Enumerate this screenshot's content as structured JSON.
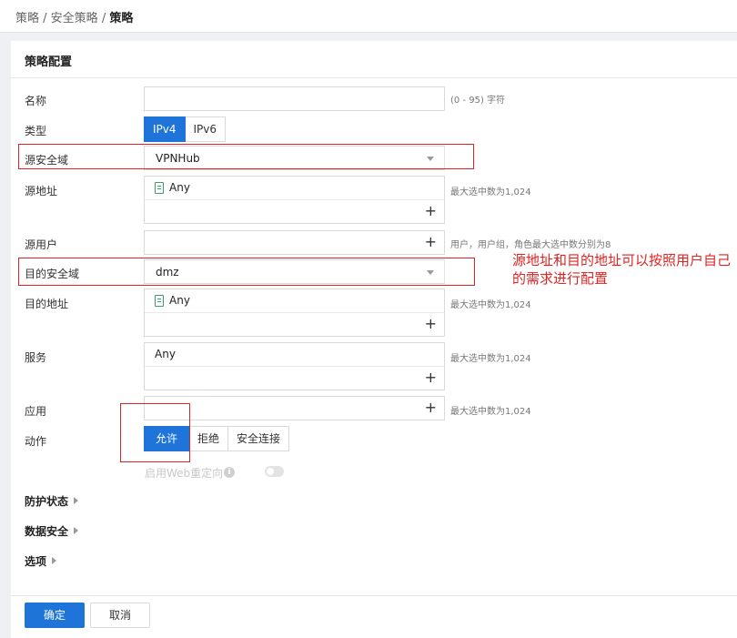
{
  "breadcrumb": {
    "items": [
      "策略",
      "安全策略"
    ],
    "sep": " / ",
    "current": "策略"
  },
  "panel": {
    "title": "策略配置"
  },
  "form": {
    "name": {
      "label": "名称",
      "value": "",
      "hint": "(0 - 95) 字符"
    },
    "type": {
      "label": "类型",
      "options": [
        "IPv4",
        "IPv6"
      ],
      "selected": "IPv4"
    },
    "src_zone": {
      "label": "源安全域",
      "value": "VPNHub"
    },
    "src_addr": {
      "label": "源地址",
      "value": "Any",
      "hint": "最大选中数为1,024"
    },
    "src_user": {
      "label": "源用户",
      "hint": "用户，用户组，角色最大选中数分别为8"
    },
    "dst_zone": {
      "label": "目的安全域",
      "value": "dmz"
    },
    "dst_addr": {
      "label": "目的地址",
      "value": "Any",
      "hint": "最大选中数为1,024"
    },
    "service": {
      "label": "服务",
      "value": "Any",
      "hint": "最大选中数为1,024"
    },
    "app": {
      "label": "应用",
      "hint": "最大选中数为1,024"
    },
    "action": {
      "label": "动作",
      "options": [
        "允许",
        "拒绝",
        "安全连接"
      ],
      "selected": "允许"
    },
    "web_redirect": {
      "label": "启用Web重定向",
      "enabled": false
    }
  },
  "sections": [
    "防护状态",
    "数据安全",
    "选项"
  ],
  "annotation": "源地址和目的地址可以按照用户自己的需求进行配置",
  "footer": {
    "ok": "确定",
    "cancel": "取消"
  },
  "icons": {
    "plus": "+",
    "info": "i"
  },
  "colors": {
    "accent": "#1e74d9",
    "annotation": "#e02424"
  }
}
